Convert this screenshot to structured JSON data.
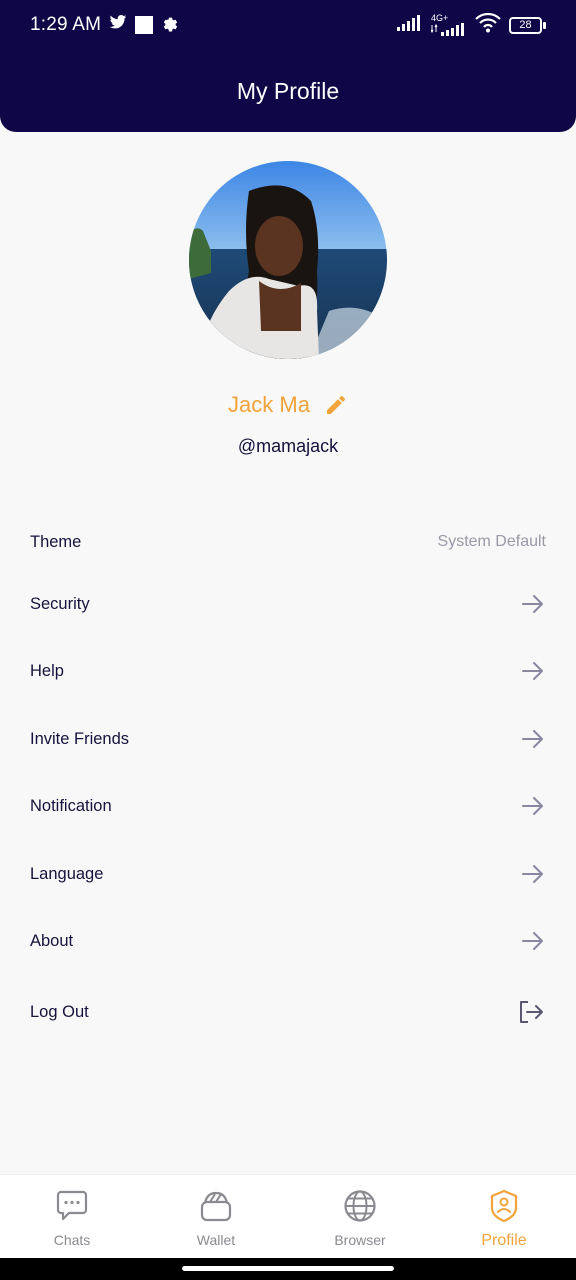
{
  "status_bar": {
    "time": "1:29 AM",
    "network": "4G+",
    "battery": "28"
  },
  "header": {
    "title": "My Profile"
  },
  "profile": {
    "name": "Jack Ma",
    "handle": "@mamajack"
  },
  "menu": {
    "theme": {
      "label": "Theme",
      "value": "System Default"
    },
    "items": [
      {
        "label": "Security"
      },
      {
        "label": "Help"
      },
      {
        "label": "Invite Friends"
      },
      {
        "label": "Notification"
      },
      {
        "label": "Language"
      },
      {
        "label": "About"
      }
    ],
    "logout": {
      "label": "Log Out"
    }
  },
  "bottom_nav": {
    "items": [
      {
        "label": "Chats",
        "icon": "chat-bubble-icon"
      },
      {
        "label": "Wallet",
        "icon": "wallet-icon"
      },
      {
        "label": "Browser",
        "icon": "globe-icon"
      },
      {
        "label": "Profile",
        "icon": "profile-badge-icon"
      }
    ],
    "active": "Profile"
  },
  "colors": {
    "header_bg": "#0e0646",
    "accent": "#f2a33a",
    "text": "#15133b",
    "muted": "#9a99a6",
    "background": "#f8f8f9"
  }
}
